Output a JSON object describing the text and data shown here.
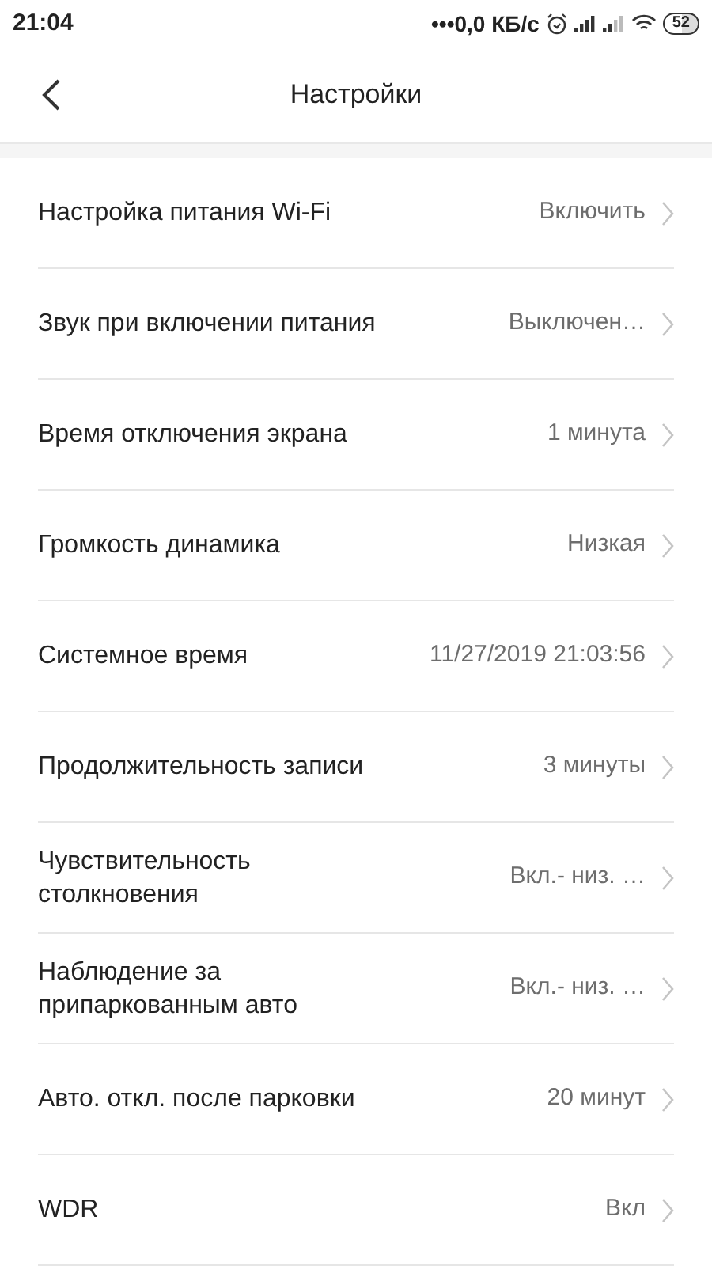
{
  "status_bar": {
    "time": "21:04",
    "network_speed": "•••0,0 КБ/с",
    "battery": "52"
  },
  "header": {
    "title": "Настройки"
  },
  "settings": [
    {
      "label": "Настройка питания Wi-Fi",
      "value": "Включить"
    },
    {
      "label": "Звук при включении питания",
      "value": "Выключен…"
    },
    {
      "label": "Время отключения экрана",
      "value": "1 минута"
    },
    {
      "label": "Громкость динамика",
      "value": "Низкая"
    },
    {
      "label": "Системное время",
      "value": "11/27/2019 21:03:56"
    },
    {
      "label": "Продолжительность записи",
      "value": "3 минуты"
    },
    {
      "label": "Чувствительность столкновения",
      "value": "Вкл.- низ. …"
    },
    {
      "label": "Наблюдение за припаркованным авто",
      "value": "Вкл.- низ. …"
    },
    {
      "label": "Авто. откл. после парковки",
      "value": "20 минут"
    },
    {
      "label": "WDR",
      "value": "Вкл"
    }
  ]
}
